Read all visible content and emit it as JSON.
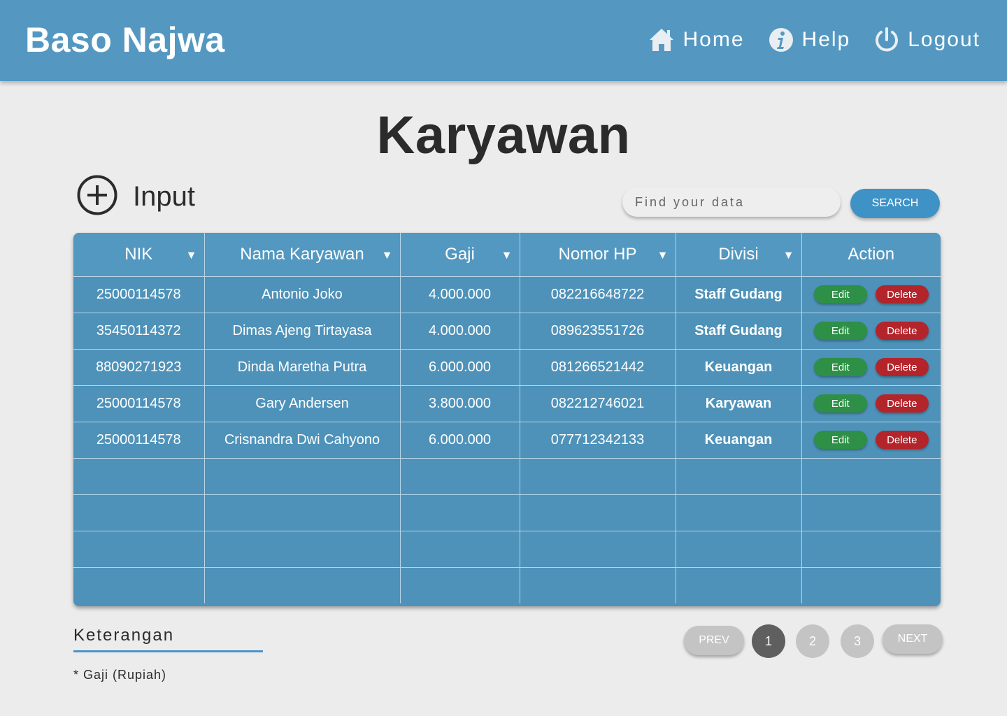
{
  "header": {
    "brand": "Baso Najwa",
    "nav": [
      {
        "label": "Home",
        "icon": "home-icon"
      },
      {
        "label": "Help",
        "icon": "info-icon"
      },
      {
        "label": "Logout",
        "icon": "power-icon"
      }
    ]
  },
  "page": {
    "title": "Karyawan",
    "input_label": "Input"
  },
  "search": {
    "placeholder": "Find your data",
    "button": "SEARCH"
  },
  "table": {
    "columns": [
      "NIK",
      "Nama Karyawan",
      "Gaji",
      "Nomor HP",
      "Divisi",
      "Action"
    ],
    "rows": [
      {
        "nik": "25000114578",
        "nama": "Antonio Joko",
        "gaji": "4.000.000",
        "hp": "082216648722",
        "divisi": "Staff Gudang"
      },
      {
        "nik": "35450114372",
        "nama": "Dimas Ajeng Tirtayasa",
        "gaji": "4.000.000",
        "hp": "089623551726",
        "divisi": "Staff Gudang"
      },
      {
        "nik": "88090271923",
        "nama": "Dinda Maretha Putra",
        "gaji": "6.000.000",
        "hp": "081266521442",
        "divisi": "Keuangan"
      },
      {
        "nik": "25000114578",
        "nama": "Gary Andersen",
        "gaji": "3.800.000",
        "hp": "082212746021",
        "divisi": "Karyawan"
      },
      {
        "nik": "25000114578",
        "nama": "Crisnandra Dwi Cahyono",
        "gaji": "6.000.000",
        "hp": "077712342133",
        "divisi": "Keuangan"
      }
    ],
    "edit_label": "Edit",
    "delete_label": "Delete"
  },
  "footer": {
    "keterangan_title": "Keterangan",
    "keterangan_note": "* Gaji (Rupiah)"
  },
  "pagination": {
    "prev": "PREV",
    "pages": [
      "1",
      "2",
      "3"
    ],
    "next": "NEXT",
    "current": "1"
  },
  "colors": {
    "header": "#5498c2",
    "table": "#4e92b9",
    "edit": "#2e8f46",
    "delete": "#b3242b",
    "search_button": "#3f92c6"
  }
}
